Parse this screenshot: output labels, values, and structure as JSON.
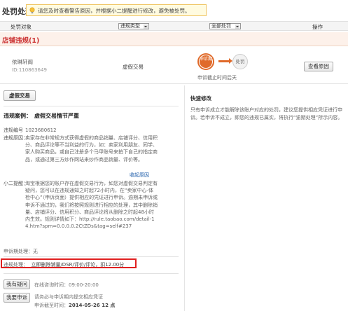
{
  "header": {
    "title": "处罚处理",
    "notice": "请您及时查看警告原因，并根据小二提醒进行修改，避免被处罚。"
  },
  "filters": {
    "object_label": "处罚对象",
    "violation_type": "违规类型",
    "status": "全部处罚",
    "operation_label": "操作"
  },
  "section": {
    "title": "店铺违规(1)"
  },
  "case": {
    "seller_name": "依琳轩阁",
    "seller_id": "ID:110863649",
    "violation": "虚假交易",
    "flow_appeal": "申诉期",
    "flow_punish": "处罚",
    "flow_caption": "申诉截止时间后天",
    "view_reason_button": "查看原因"
  },
  "detail": {
    "tab": "虚假交易",
    "heading_key": "违规案例：",
    "heading_value": "虚假交易情节严重",
    "fields": [
      {
        "key": "违规编号",
        "value": "1023680612"
      },
      {
        "key": "违规原因：",
        "value": "卖家存在非常规方式获得虚假的商品销量、店铺评分、信用积分、商品评论等不当利益的行为，如：卖家利用朋友、同学、家人购买商品，或自己注册多个马甲账号来拍下自己的指定商品，或通过第三方炒作网站来炒作商品销量、评价等。"
      },
      {
        "key": "小二提醒：",
        "value": "淘宝根据您的账户存在虚假交易行为，如您对虚假交易判定有疑问，您可以在违规通知之时起72小时内，在“卖家中心-体检中心”（申诉页面）提供相应的凭证进行申诉。逾期未申诉或申诉不通过的，我们将按照规则进行相应的处理，其中删除销量、店铺评分、信用积分、商品评论将从删除之时起48小时内生效。规则详情如下：http://rule.taobao.com/detail-14.htm?spm=0.0.0.0.2CtZDs&tag=self#237"
      }
    ],
    "rule_link": "收起原因",
    "appeal_result": "申诉期处理：无",
    "penalty_key": "违规处理：",
    "penalty_value": "立即删除销量/DSR/评价/评论，扣12.00分",
    "question_button": "我有疑问",
    "online_time": "在线咨询时间：09:00-20:00",
    "appeal_button": "我要申诉",
    "appeal_note": "请务必与申诉期内提交相应凭证",
    "deadline_label": "申诉截至时间：",
    "deadline_value": "2014-05-26 12 点"
  },
  "quick": {
    "title": "快速修改",
    "text": "只有申诉成立才能解除该账户对应的处罚，建议您提供相应凭证进行申诉。若申诉不成立，即您的违规已属实，将执行“逾期处理”所示内容。"
  }
}
